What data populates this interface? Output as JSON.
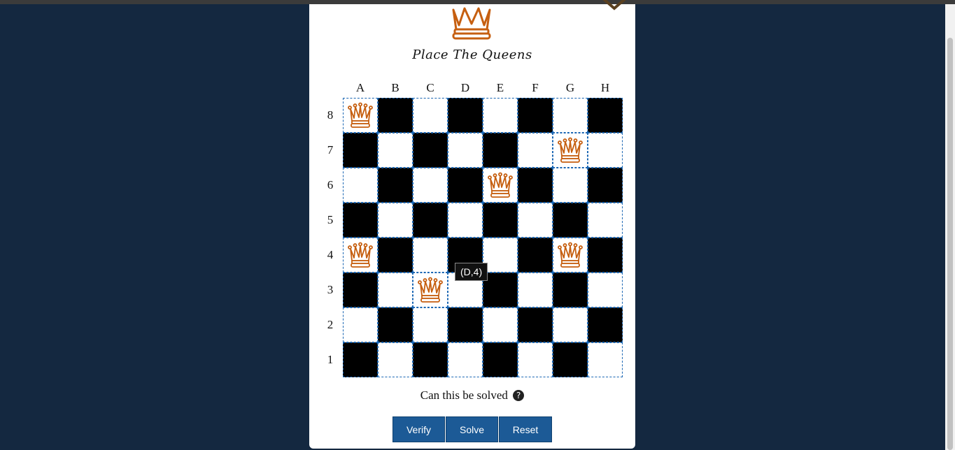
{
  "modal": {
    "title": "Place The Queens",
    "question": "Can this be solved",
    "help_glyph": "?"
  },
  "board": {
    "columns": [
      "A",
      "B",
      "C",
      "D",
      "E",
      "F",
      "G",
      "H"
    ],
    "rows": [
      "8",
      "7",
      "6",
      "5",
      "4",
      "3",
      "2",
      "1"
    ],
    "queens": [
      "A8",
      "G7",
      "E6",
      "A4",
      "G4",
      "C3"
    ],
    "hover_tooltip": "(D,4)"
  },
  "buttons": {
    "verify": "Verify",
    "solve": "Solve",
    "reset": "Reset"
  },
  "colors": {
    "page_background": "#142840",
    "queen": "#c65f10",
    "button": "#1c5a96",
    "dark_square": "#000000",
    "light_square": "#ffffff",
    "cell_border": "#1a66b3"
  },
  "icons": {
    "close": "close-icon",
    "logo": "crown-icon",
    "queen": "queen-icon",
    "help": "question-circle-icon"
  }
}
